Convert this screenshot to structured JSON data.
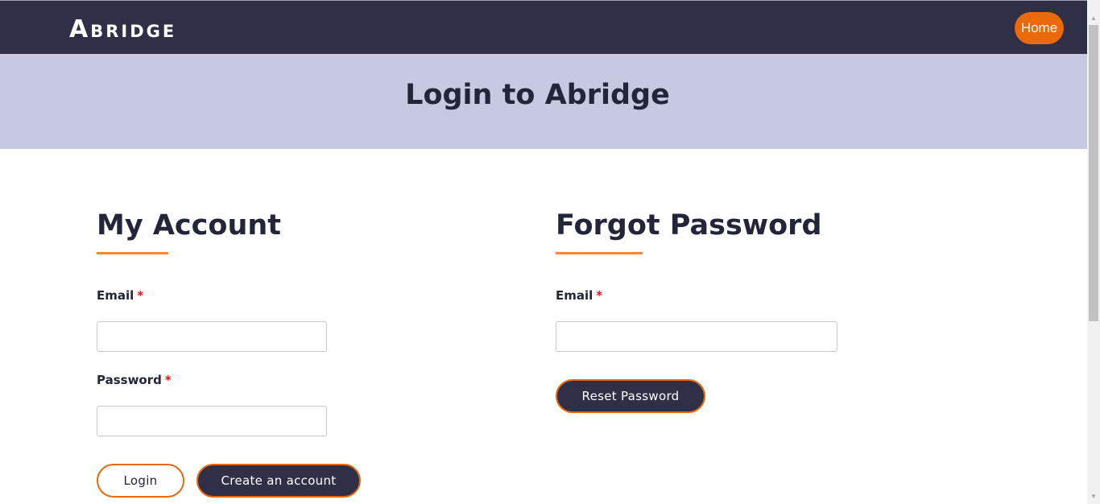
{
  "header": {
    "logo": "Abridge",
    "home_label": "Home"
  },
  "hero": {
    "title": "Login to Abridge"
  },
  "account": {
    "title": "My Account",
    "email_label": "Email",
    "password_label": "Password",
    "required_mark": "*",
    "email_value": "",
    "password_value": "",
    "login_label": "Login",
    "create_label": "Create an account"
  },
  "forgot": {
    "title": "Forgot Password",
    "email_label": "Email",
    "required_mark": "*",
    "email_value": "",
    "reset_label": "Reset Password"
  },
  "colors": {
    "nav_bg": "#2f3048",
    "accent": "#ea6a0b",
    "hero_bg": "#c7c9e3",
    "required": "#e0161d"
  },
  "icons": {
    "scroll_up": "▲",
    "scroll_down": "▼"
  }
}
